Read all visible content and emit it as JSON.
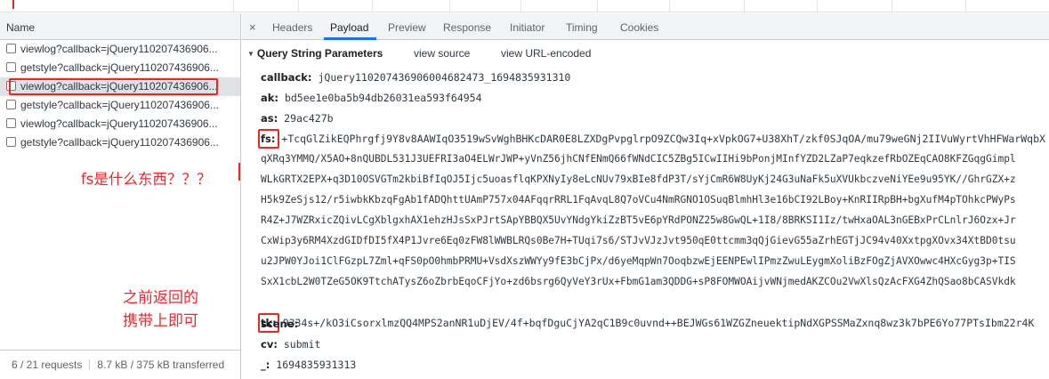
{
  "left_panel": {
    "column_header": "Name",
    "requests": [
      {
        "name": "viewlog?callback=jQuery110207436906..."
      },
      {
        "name": "getstyle?callback=jQuery110207436906..."
      },
      {
        "name": "viewlog?callback=jQuery110207436906..."
      },
      {
        "name": "getstyle?callback=jQuery110207436906..."
      },
      {
        "name": "viewlog?callback=jQuery110207436906..."
      },
      {
        "name": "getstyle?callback=jQuery110207436906..."
      }
    ],
    "footer": {
      "requests": "6 / 21 requests",
      "transferred": "8.7 kB / 375 kB transferred"
    }
  },
  "annotations": {
    "fs_question": "fs是什么东西？？？",
    "tk_line1": "之前返回的",
    "tk_line2": "携带上即可",
    "annotation_color": "#f4232b"
  },
  "tabs": {
    "close": "×",
    "items": [
      "Headers",
      "Payload",
      "Preview",
      "Response",
      "Initiator",
      "Timing",
      "Cookies"
    ],
    "active": "Payload"
  },
  "section": {
    "title": "Query String Parameters",
    "view_source": "view source",
    "view_url_encoded": "view URL-encoded"
  },
  "params": {
    "callback": {
      "key": "callback:",
      "value": "jQuery110207436906004682473_1694835931310"
    },
    "ak": {
      "key": "ak:",
      "value": "bd5ee1e0ba5b94db26031ea593f64954"
    },
    "as": {
      "key": "as:",
      "value": "29ac427b"
    },
    "fs": {
      "key": "fs:",
      "value": "+TcqGlZikEQPhrgfj9Y8v8AAWIqO3519wSvWghBHKcDAR0E8LZXDgPvpglrpO9ZCQw3Iq+xVpkOG7+U38XhT/zkf0SJqOA/mu79weGNj2IIVuWyrtVhHFWarWqbX",
      "continuation": [
        "qXRq3YMMQ/X5AO+8nQUBDL531J3UEFRI3aO4ELWrJWP+yVnZ56jhCNfENmQ66fWNdCIC5ZBg5ICwIIHi9bPonjMInfYZD2LZaP7eqkzefRbOZEqCAO8KFZGqgGimpl",
        "WLkGRTX2EPX+q3D10OSVGTm2kbiBfIqOJ5Ijc5uoasflqKPXNyIy8eLcNUv79xBIe8fdP3T/sYjCmR6W8UyKj24G3uNaFk5uXVUkbczveNiYEe9u95YK//GhrGZX+z",
        "H5k9ZeSjs12/r5iwbkKbzqFgAb1fADQhttUAmP757x04AFqqrRRL1FqAvqL8Q7oVCu4NmRGNO1OSuqBlmhHl3e16bCI92LBoy+KnRIIRpBH+bgXufM4pTOhkcPWyPs",
        "R4Z+J7WZRxicZQivLCgXblgxhAX1ehzHJsSxPJrtSApYBBQX5UvYNdgYkiZzBT5vE6pYRdPONZ25w8GwQL+1I8/8BRKSI1Iz/twHxaOAL3nGEBxPrCLnlrJ6Ozx+Jr",
        "CxWip3y6RM4XzdGIDfDI5fX4P1Jvre6Eq0zFW8lWWBLRQs0Be7H+TUqi7s6/STJvVJzJvt950qE0ttcmm3qQjGievG55aZrhEGTjJC94v40XxtpgXOvx34XtBD0tsu",
        "u2JPW0YJoi1ClFGzpL7Zml+qFS0pO0hmbPRMU+VsdXszWWYy9fE3bCjPx/d6yeMqpWn7OoqbzwEjEENPEwlIPmzZwuLEygmXoliBzFOgZjAVXOwwc4HXcGyg3p+TIS",
        "SxX1cbL2W0TZeG5OK9TtchATysZ6oZbrbEqoCFjYo+zd6bsrg6QyVeY3rUx+FbmG1am3QDDG+sP8FOMWOAijvWNjmedAKZCOu2VwXlsQzAcFXG4ZhQSao8bCASVkdk"
      ]
    },
    "tk": {
      "key": "tk:",
      "value": "9334s+/kO3iCsorxlmzQQ4MPS2anNR1uDjEV/4f+bqfDguCjYA2qC1B9c0uvnd++BEJWGs61WZGZneuektipNdXGPSSMaZxnq8wz3k7bPE6Yo77PTsIbm22r4K"
    },
    "scene": {
      "key": "scene:",
      "value": ""
    },
    "cv": {
      "key": "cv:",
      "value": "submit"
    },
    "ts": {
      "key": "_:",
      "value": "1694835931313"
    }
  },
  "colors": {
    "highlight_box": "#e8291c",
    "active_tab_underline": "#1a73e8",
    "selected_row": "#dfe1e5"
  }
}
